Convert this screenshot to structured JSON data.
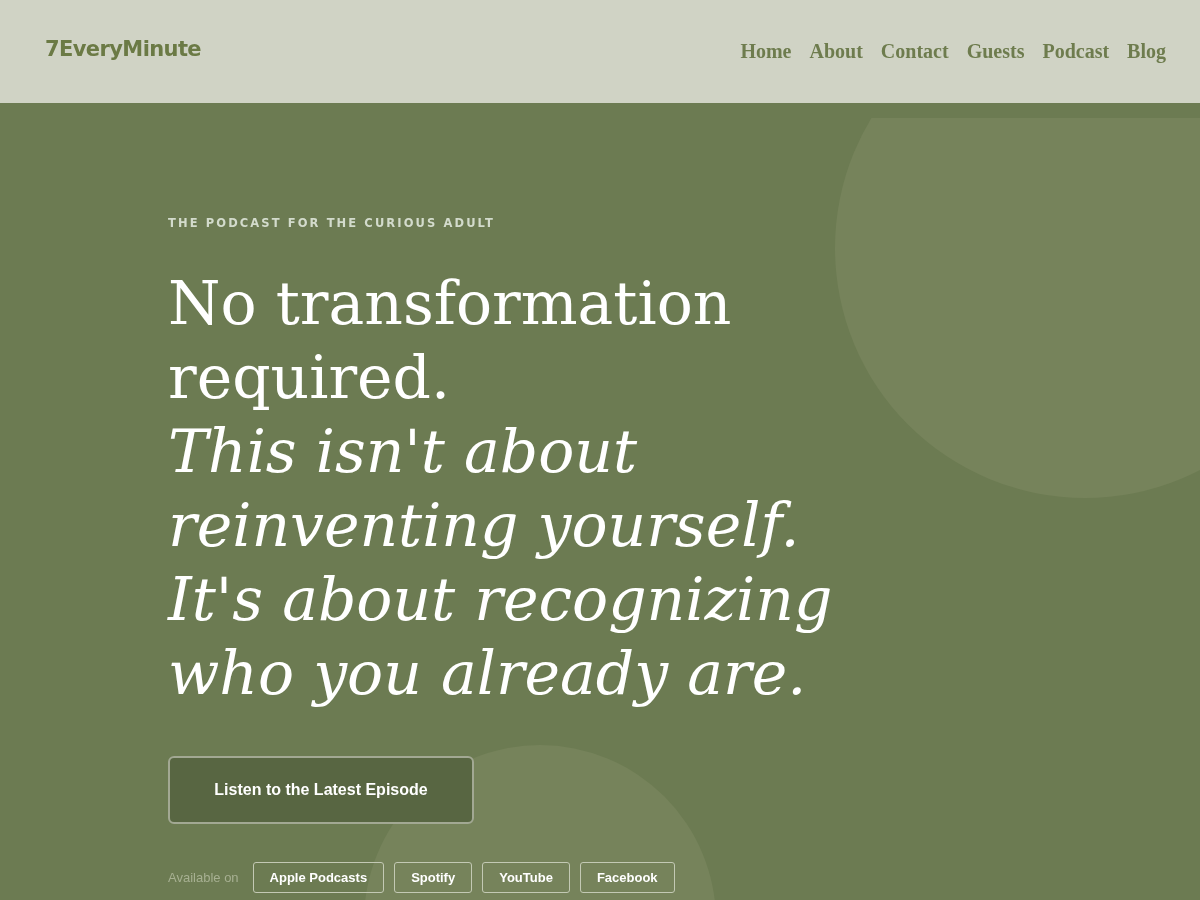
{
  "header": {
    "logo": "7EveryMinute",
    "nav": [
      {
        "label": "Home"
      },
      {
        "label": "About"
      },
      {
        "label": "Contact"
      },
      {
        "label": "Guests"
      },
      {
        "label": "Podcast"
      },
      {
        "label": "Blog"
      }
    ]
  },
  "hero": {
    "eyebrow": "THE PODCAST FOR THE CURIOUS ADULT",
    "headline": "No transformation required. *This isn't about reinventing yourself. It's about recognizing who you already are.*",
    "cta": "Listen to the Latest Episode",
    "platforms": {
      "label": "Available on",
      "links": [
        "Apple Podcasts",
        "Spotify",
        "YouTube",
        "Facebook"
      ]
    }
  }
}
